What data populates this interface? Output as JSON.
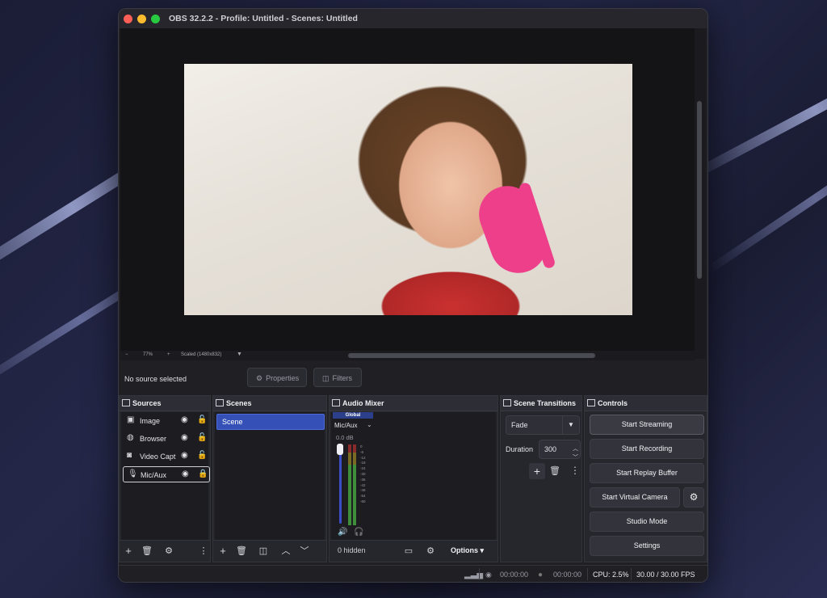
{
  "window": {
    "title": "OBS 32.2.2 - Profile: Untitled - Scenes: Untitled"
  },
  "preview": {
    "zoom_minus": "−",
    "zoom_level": "77%",
    "zoom_plus": "+",
    "scale_mode": "Scaled (1480x832)",
    "scale_caret": "▼"
  },
  "source_toolbar": {
    "status": "No source selected",
    "properties_label": "Properties",
    "filters_label": "Filters"
  },
  "sources": {
    "title": "Sources",
    "items": [
      {
        "label": "Image",
        "icon": "image-icon",
        "glyph": "▣",
        "visible": true,
        "locked": false
      },
      {
        "label": "Browser",
        "icon": "globe-icon",
        "glyph": "◍",
        "visible": true,
        "locked": false
      },
      {
        "label": "Video Capt",
        "icon": "camera-icon",
        "glyph": "◙",
        "visible": true,
        "locked": false
      },
      {
        "label": "Mic/Aux",
        "icon": "microphone-icon",
        "glyph": "🎙",
        "visible": true,
        "locked": true,
        "selected": true
      }
    ]
  },
  "scenes": {
    "title": "Scenes",
    "items": [
      {
        "label": "Scene",
        "selected": true
      }
    ]
  },
  "audio_mixer": {
    "title": "Audio Mixer",
    "global_label": "Global",
    "channel_name": "Mic/Aux",
    "channel_level": "0.0 dB",
    "scale": [
      "0",
      "-6",
      "-12",
      "-18",
      "-24",
      "-30",
      "-36",
      "-42",
      "-48",
      "-54",
      "-60"
    ],
    "hidden_label": "0 hidden",
    "options_label": "Options"
  },
  "scene_transitions": {
    "title": "Scene Transitions",
    "transition": "Fade",
    "duration_label": "Duration",
    "duration_value": "300"
  },
  "controls": {
    "title": "Controls",
    "start_streaming": "Start Streaming",
    "start_recording": "Start Recording",
    "start_replay_buffer": "Start Replay Buffer",
    "start_virtual_camera": "Start Virtual Camera",
    "studio_mode": "Studio Mode",
    "settings": "Settings"
  },
  "status_bar": {
    "stream_time": "00:00:00",
    "record_time": "00:00:00",
    "cpu": "CPU: 2.5%",
    "fps": "30.00 / 30.00 FPS"
  },
  "colors": {
    "accent_selected": "#3551b8",
    "meter_green": "#3f8f3a",
    "meter_red": "#8a2a2a"
  }
}
